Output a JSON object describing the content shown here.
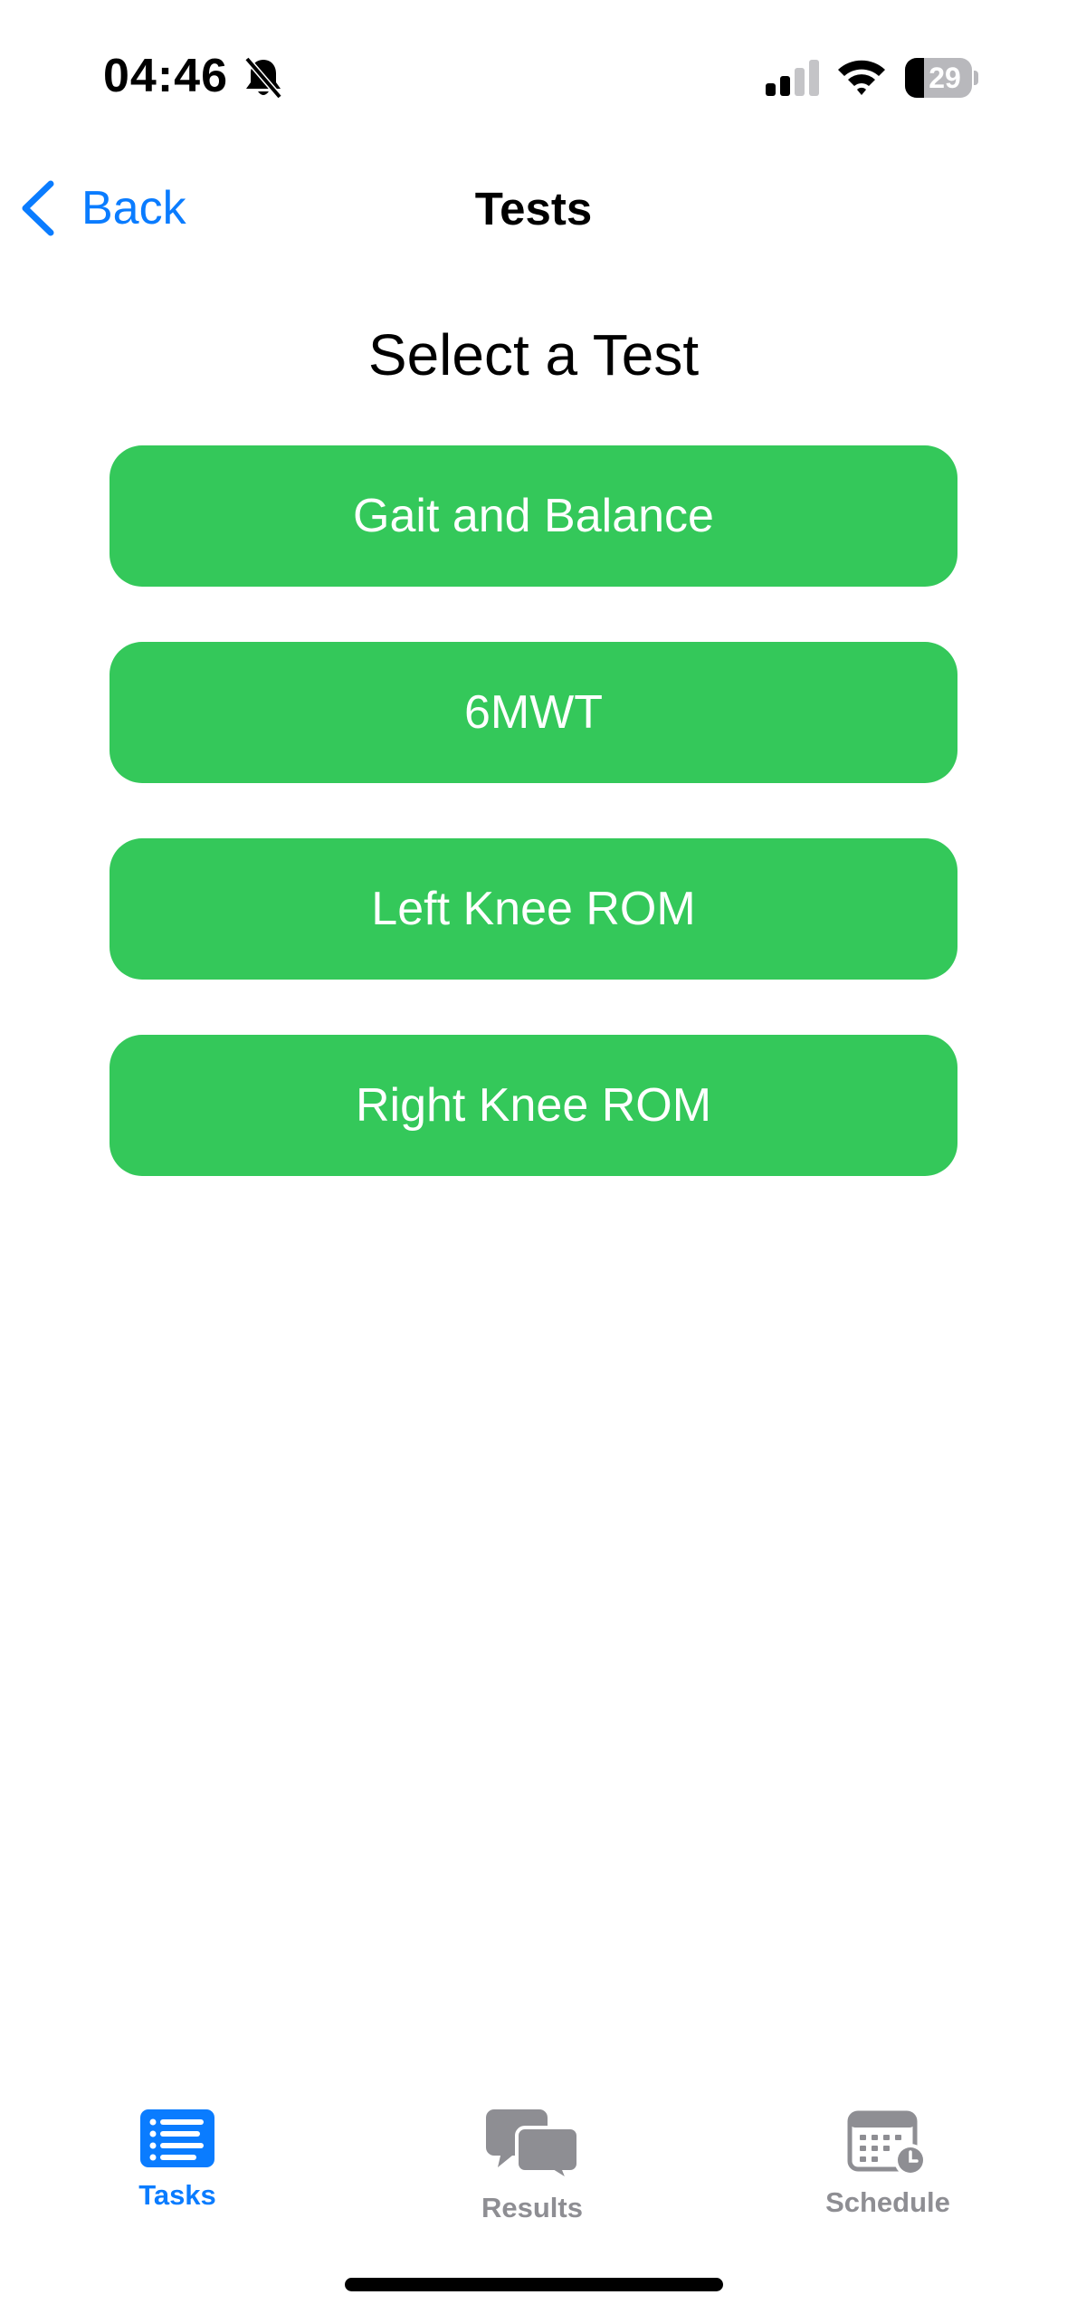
{
  "status_bar": {
    "time": "04:46",
    "battery_level": "29",
    "battery_fraction": 0.29,
    "silent_mode_icon": "bell-slash-icon",
    "signal_icon": "cellular-signal-icon",
    "wifi_icon": "wifi-icon"
  },
  "nav": {
    "back_label": "Back",
    "title": "Tests"
  },
  "main": {
    "heading": "Select a Test",
    "tests": [
      {
        "label": "Gait and Balance"
      },
      {
        "label": "6MWT"
      },
      {
        "label": "Left Knee ROM"
      },
      {
        "label": "Right Knee ROM"
      }
    ]
  },
  "tab_bar": {
    "tabs": [
      {
        "label": "Tasks",
        "icon": "list-icon",
        "selected": true
      },
      {
        "label": "Results",
        "icon": "chat-bubbles-icon",
        "selected": false
      },
      {
        "label": "Schedule",
        "icon": "calendar-clock-icon",
        "selected": false
      }
    ]
  },
  "colors": {
    "accent": "#0a7cff",
    "button_green": "#34c85a",
    "inactive_tab": "#8e8e93"
  }
}
